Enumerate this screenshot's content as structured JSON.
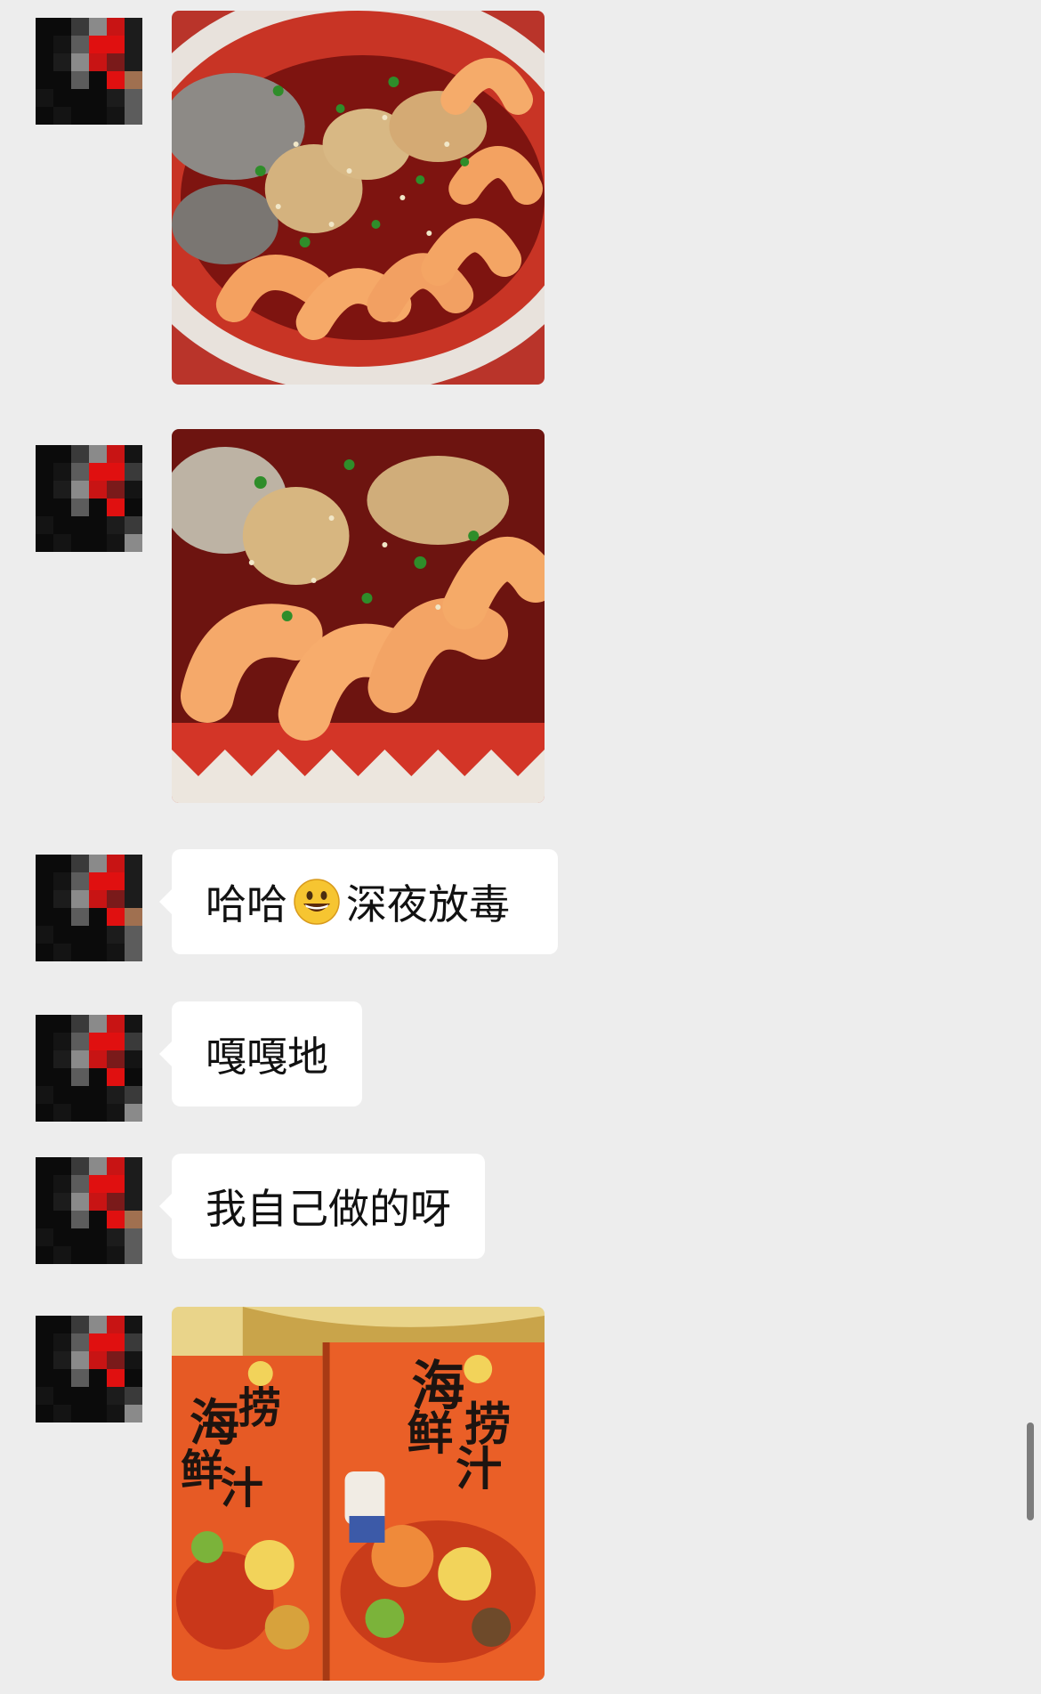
{
  "messages": [
    {
      "type": "image",
      "image_name": "seafood-platter-photo"
    },
    {
      "type": "image",
      "image_name": "shrimp-closeup-photo"
    },
    {
      "type": "text",
      "before": "哈哈",
      "emoji": "grinning-face-emoji",
      "after": "深夜放毒"
    },
    {
      "type": "text",
      "text": "嘎嘎地"
    },
    {
      "type": "text",
      "text": "我自己做的呀"
    },
    {
      "type": "image",
      "image_name": "seafood-sauce-package-photo"
    }
  ],
  "colors": {
    "background": "#ededed",
    "bubble": "#ffffff",
    "text": "#111111",
    "scrollbar": "#7c7c7c"
  }
}
